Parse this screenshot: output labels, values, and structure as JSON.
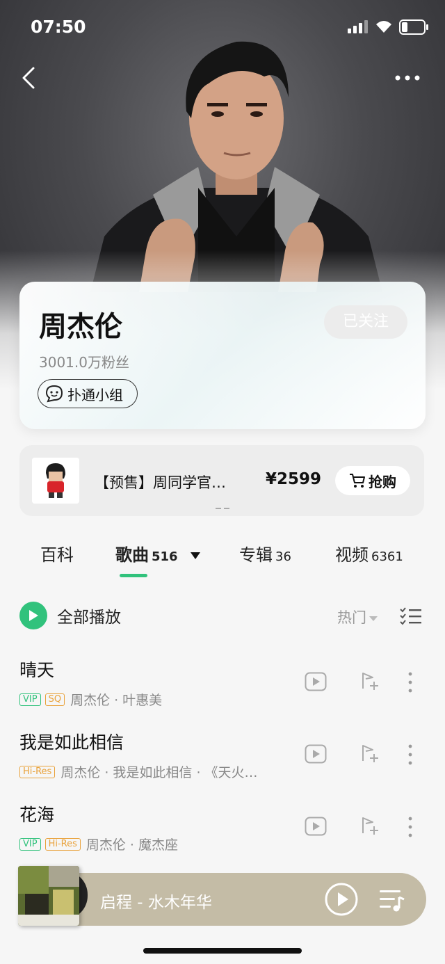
{
  "status_bar": {
    "time": "07:50"
  },
  "artist": {
    "name": "周杰伦",
    "followers": "3001.0万粉丝",
    "follow_label": "已关注",
    "group_label": "扑通小组"
  },
  "promo": {
    "title": "【预售】周同学官…",
    "price": "¥2599",
    "buy_label": "抢购"
  },
  "tabs": [
    {
      "label": "百科",
      "count": ""
    },
    {
      "label": "歌曲",
      "count": "516"
    },
    {
      "label": "专辑",
      "count": "36"
    },
    {
      "label": "视频",
      "count": "6361"
    }
  ],
  "list_header": {
    "play_all_label": "全部播放",
    "sort_label": "热门"
  },
  "songs": [
    {
      "title": "晴天",
      "tags": [
        "VIP",
        "SQ"
      ],
      "meta": "周杰伦 · 叶惠美"
    },
    {
      "title": "我是如此相信",
      "tags": [
        "Hi-Res"
      ],
      "meta": "周杰伦 · 我是如此相信 · 《天火…"
    },
    {
      "title": "花海",
      "tags": [
        "VIP",
        "Hi-Res"
      ],
      "meta": "周杰伦 · 魔杰座"
    }
  ],
  "mini_player": {
    "now_playing": "启程 - 水木年华"
  },
  "colors": {
    "accent": "#31c27c",
    "tag_gold": "#e9a23b",
    "player_bg": "#c4bca6"
  }
}
